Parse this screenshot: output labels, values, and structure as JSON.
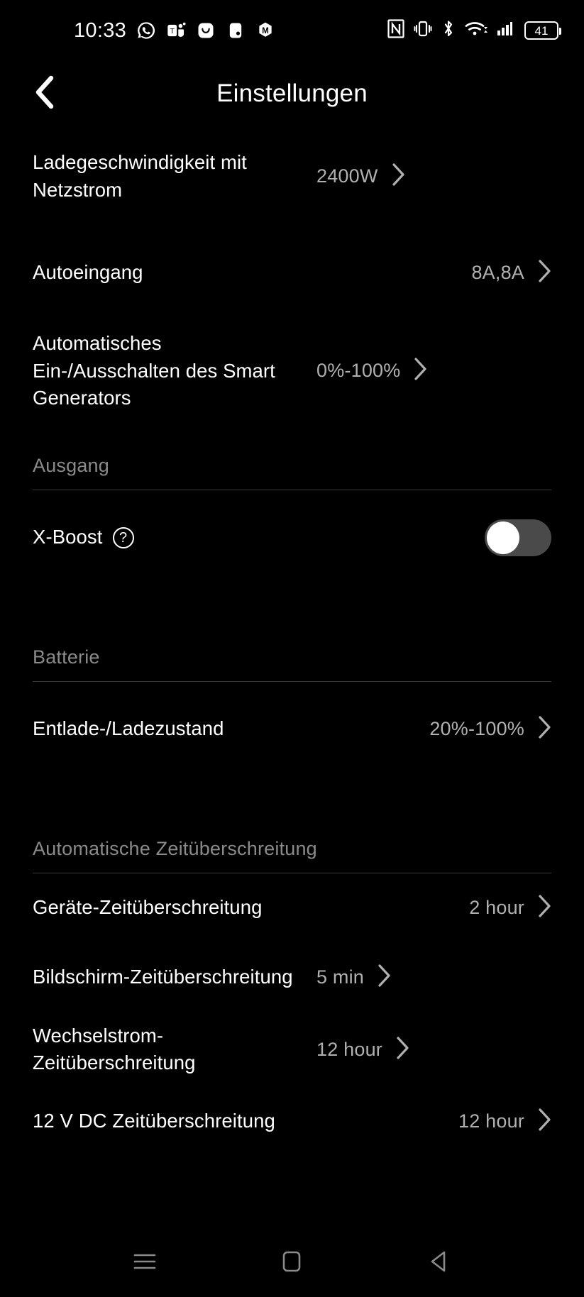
{
  "statusbar": {
    "clock": "10:33",
    "app_icons": [
      "whatsapp-icon",
      "teams-icon",
      "smile-app-icon",
      "notes-app-icon",
      "m-app-icon"
    ],
    "system_icons": [
      "nfc-icon",
      "vibrate-icon",
      "bluetooth-icon",
      "wifi-icon",
      "cellular-signal-icon"
    ],
    "battery_level": "41"
  },
  "header": {
    "title": "Einstellungen",
    "back_icon": "chevron-left-icon"
  },
  "sections": [
    {
      "id": "top",
      "heading": null,
      "rows": [
        {
          "label": "Ladegeschwindigkeit mit Netzstrom",
          "value": "2400W",
          "type": "nav"
        },
        {
          "label": "Autoeingang",
          "value": "8A,8A",
          "type": "nav"
        },
        {
          "label": "Automatisches Ein-/Ausschalten des Smart Generators",
          "value": "0%-100%",
          "type": "nav"
        }
      ]
    },
    {
      "id": "ausgang",
      "heading": "Ausgang",
      "rows": [
        {
          "label": "X-Boost",
          "value": "",
          "type": "toggle",
          "toggle_on": false,
          "help": "?"
        }
      ]
    },
    {
      "id": "batterie",
      "heading": "Batterie",
      "rows": [
        {
          "label": "Entlade-/Ladezustand",
          "value": "20%-100%",
          "type": "nav"
        }
      ]
    },
    {
      "id": "timeout",
      "heading": "Automatische Zeitüberschreitung",
      "rows": [
        {
          "label": "Geräte-Zeitüberschreitung",
          "value": "2 hour",
          "type": "nav"
        },
        {
          "label": "Bildschirm-Zeitüberschreitung",
          "value": "5 min",
          "type": "nav"
        },
        {
          "label": "Wechselstrom-Zeitüberschreitung",
          "value": "12 hour",
          "type": "nav"
        },
        {
          "label": "12 V DC Zeitüberschreitung",
          "value": "12 hour",
          "type": "nav"
        }
      ]
    }
  ],
  "navbar": {
    "recents_icon": "recents-menu-icon",
    "home_icon": "home-square-icon",
    "back_icon": "back-triangle-icon"
  },
  "colors": {
    "background": "#000000",
    "primary_text": "#ffffff",
    "secondary_text": "#b0b0b0",
    "section_heading": "#8a8a8a",
    "divider": "#3a3a3a",
    "toggle_track_off": "#4a4a4a"
  }
}
